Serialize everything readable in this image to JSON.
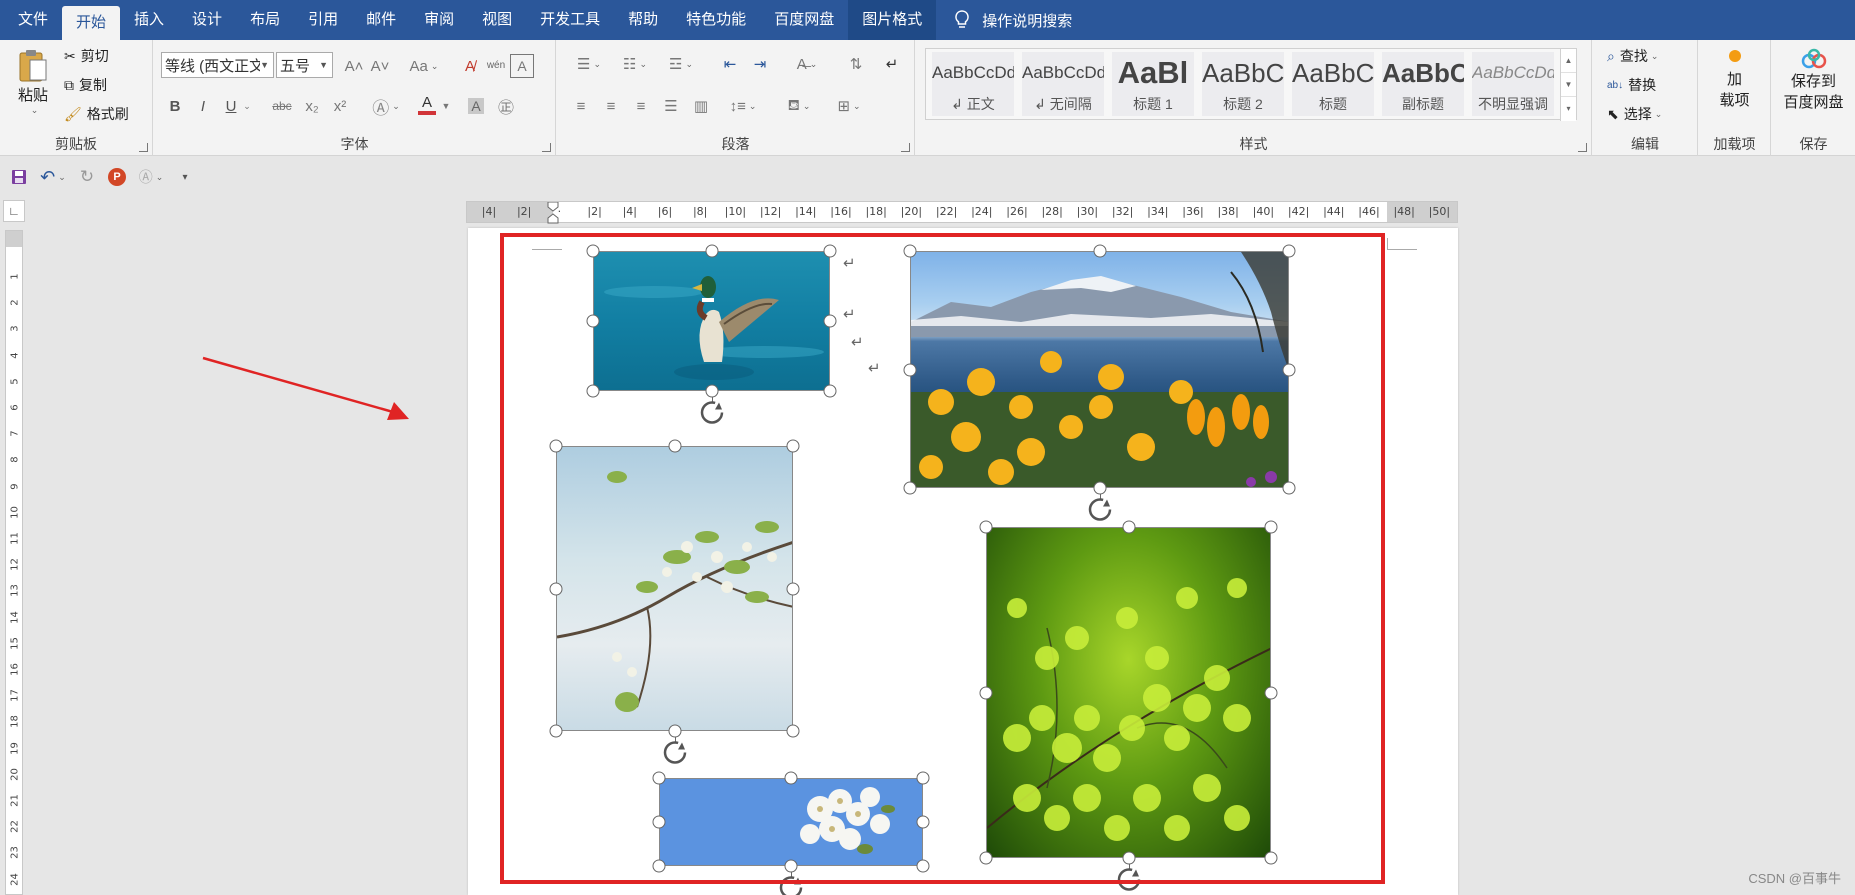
{
  "menu": {
    "tabs": [
      "文件",
      "开始",
      "插入",
      "设计",
      "布局",
      "引用",
      "邮件",
      "审阅",
      "视图",
      "开发工具",
      "帮助",
      "特色功能",
      "百度网盘",
      "图片格式"
    ],
    "search_label": "操作说明搜索"
  },
  "clipboard": {
    "paste": "粘贴",
    "cut": "剪切",
    "copy": "复制",
    "format_painter": "格式刷",
    "group_label": "剪贴板"
  },
  "font": {
    "font_name": "等线 (西文正文",
    "font_size": "五号",
    "group_label": "字体",
    "bold": "B",
    "italic": "I",
    "underline": "U",
    "strike": "abc",
    "subscript": "x₂",
    "superscript": "x²",
    "font_color_letter": "A",
    "font_color": "#d13438",
    "highlight_color": "#a0a0a0",
    "case_label": "Aa",
    "grow": "A˄",
    "shrink": "A˅",
    "phonetic": "wén"
  },
  "paragraph": {
    "group_label": "段落"
  },
  "styles": {
    "group_label": "样式",
    "items": [
      {
        "sample": "AaBbCcDd",
        "name": "↲ 正文"
      },
      {
        "sample": "AaBbCcDd",
        "name": "↲ 无间隔"
      },
      {
        "sample": "AaBl",
        "name": "标题 1"
      },
      {
        "sample": "AaBbC",
        "name": "标题 2"
      },
      {
        "sample": "AaBbC",
        "name": "标题"
      },
      {
        "sample": "AaBbC",
        "name": "副标题"
      },
      {
        "sample": "AaBbCcDd",
        "name": "不明显强调"
      }
    ]
  },
  "editing": {
    "find": "查找",
    "replace": "替换",
    "select": "选择",
    "group_label": "编辑"
  },
  "addins": {
    "line1": "加",
    "line2": "载项",
    "group_label": "加载项"
  },
  "save_baidu": {
    "line1": "保存到",
    "line2": "百度网盘",
    "group_label": "保存"
  },
  "ruler": {
    "h_labels": [
      "4",
      "2",
      "",
      "2",
      "4",
      "6",
      "8",
      "10",
      "12",
      "14",
      "16",
      "18",
      "20",
      "22",
      "24",
      "26",
      "28",
      "30",
      "32",
      "34",
      "36",
      "38",
      "40",
      "42",
      "44",
      "46",
      "48",
      "50"
    ],
    "v_labels": [
      "1",
      "2",
      "3",
      "4",
      "5",
      "6",
      "7",
      "8",
      "9",
      "10",
      "11",
      "12",
      "13",
      "14",
      "15",
      "16",
      "17",
      "18",
      "19",
      "20",
      "21",
      "22",
      "23",
      "24"
    ]
  },
  "document": {
    "paragraph_mark": "↵",
    "photos": [
      {
        "name": "duck-photo",
        "subject": "duck on water"
      },
      {
        "name": "mountain-flowers-photo",
        "subject": "mountain lake with yellow flowers"
      },
      {
        "name": "blossom-branch-photo",
        "subject": "blossom branch"
      },
      {
        "name": "fern-leaves-photo",
        "subject": "green fern leaves"
      },
      {
        "name": "white-flowers-photo",
        "subject": "white flowers on blue"
      }
    ]
  },
  "colors": {
    "title_bar": "#2b579a",
    "selection_frame": "#e02424",
    "annotation_arrow": "#e02424"
  },
  "watermark": "CSDN @百事牛"
}
